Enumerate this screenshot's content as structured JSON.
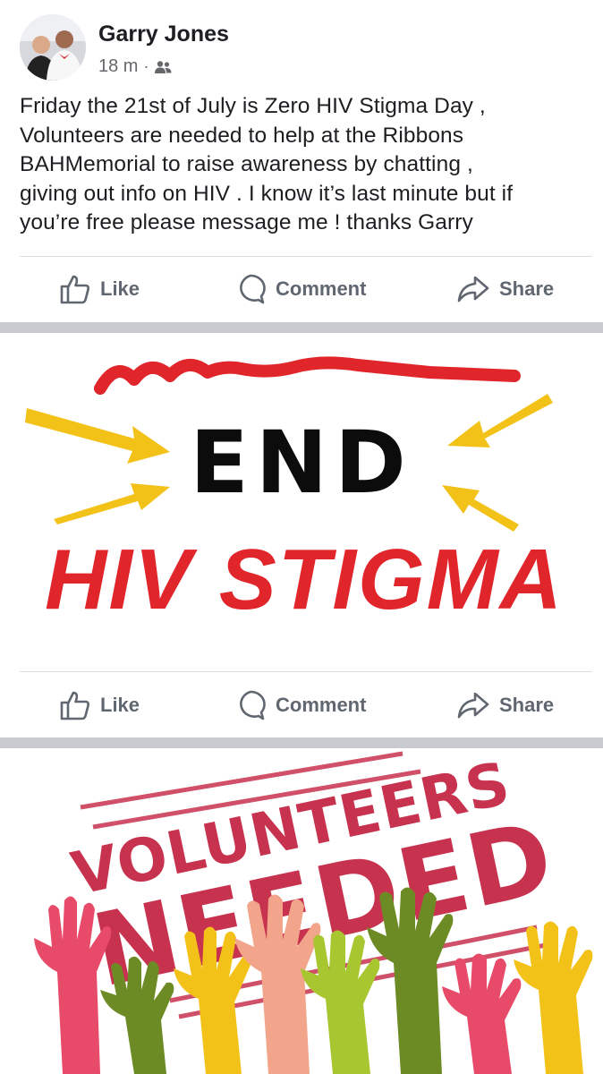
{
  "post": {
    "author": "Garry Jones",
    "time": "18 m",
    "audience_icon": "friends-icon",
    "text": "Friday the 21st of July is Zero HIV Stigma Day ,\nVolunteers are needed to help at the Ribbons\nBAHMemorial to raise awareness by chatting ,\ngiving out info on HIV . I know it’s last minute but if\nyou’re free please message me ! thanks Garry"
  },
  "actions": {
    "like": "Like",
    "comment": "Comment",
    "share": "Share"
  },
  "images": {
    "first": {
      "line1": "END",
      "line2": "HIV STIGMA"
    },
    "second": {
      "line1": "VOLUNTEERS",
      "line2": "NEEDED"
    }
  },
  "colors": {
    "red": "#e0252b",
    "yellow": "#f3c219",
    "text": "#1c1e21",
    "muted": "#65676b",
    "action": "#606770"
  }
}
